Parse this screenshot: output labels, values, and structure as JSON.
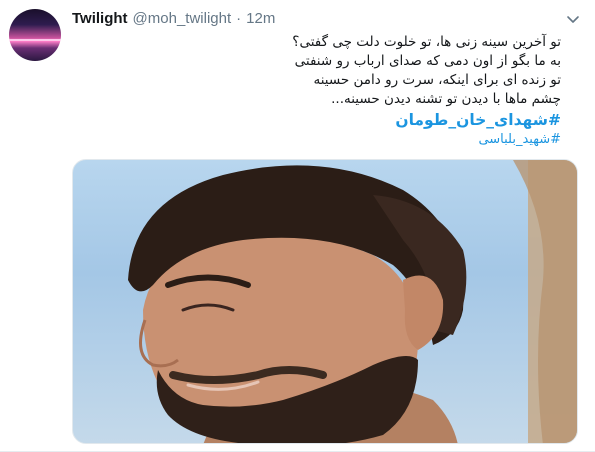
{
  "tweet": {
    "author_name": "Twilight",
    "handle": "@moh_twilight",
    "separator": "·",
    "time": "12m",
    "lines": [
      "تو آخرین سینه زنی ها، تو خلوت دلت چی گفتی؟",
      "به ما بگو از اون دمی که صدای ارباب رو شنفتی",
      "تو زنده ای برای اینکه، سرت رو دامن حسینه",
      "چشم ماها با دیدن تو تشنه دیدن حسینه..."
    ],
    "hashtags": [
      "#شهدای_خان_طومان",
      "#شهید_بلباسی"
    ]
  },
  "icons": {
    "menu": "chevron-down-icon",
    "avatar": "avatar-image",
    "photo": "tweet-photo"
  },
  "colors": {
    "link": "#1b95e0",
    "muted": "#657786",
    "text": "#14171a"
  }
}
